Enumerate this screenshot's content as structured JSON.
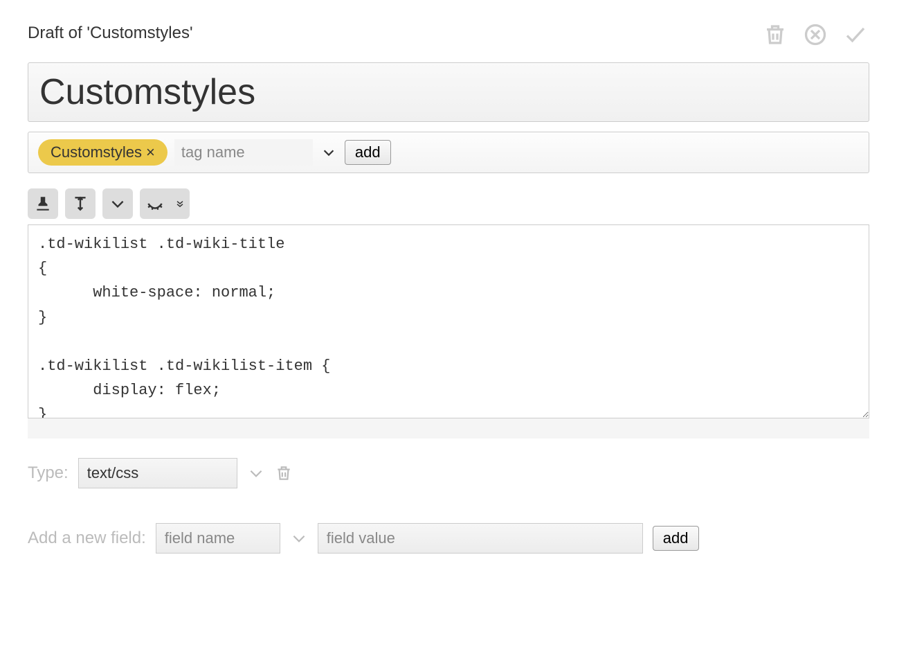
{
  "header": {
    "draft_label": "Draft of 'Customstyles'"
  },
  "title": {
    "value": "Customstyles"
  },
  "tags": {
    "existing": [
      {
        "label": "Customstyles"
      }
    ],
    "input_placeholder": "tag name",
    "add_button": "add"
  },
  "editor": {
    "content": ".td-wikilist .td-wiki-title\n{\n      white-space: normal;\n}\n\n.td-wikilist .td-wikilist-item {\n      display: flex;\n}"
  },
  "type_field": {
    "label": "Type:",
    "value": "text/css"
  },
  "new_field": {
    "label": "Add a new field:",
    "name_placeholder": "field name",
    "value_placeholder": "field value",
    "add_button": "add"
  }
}
